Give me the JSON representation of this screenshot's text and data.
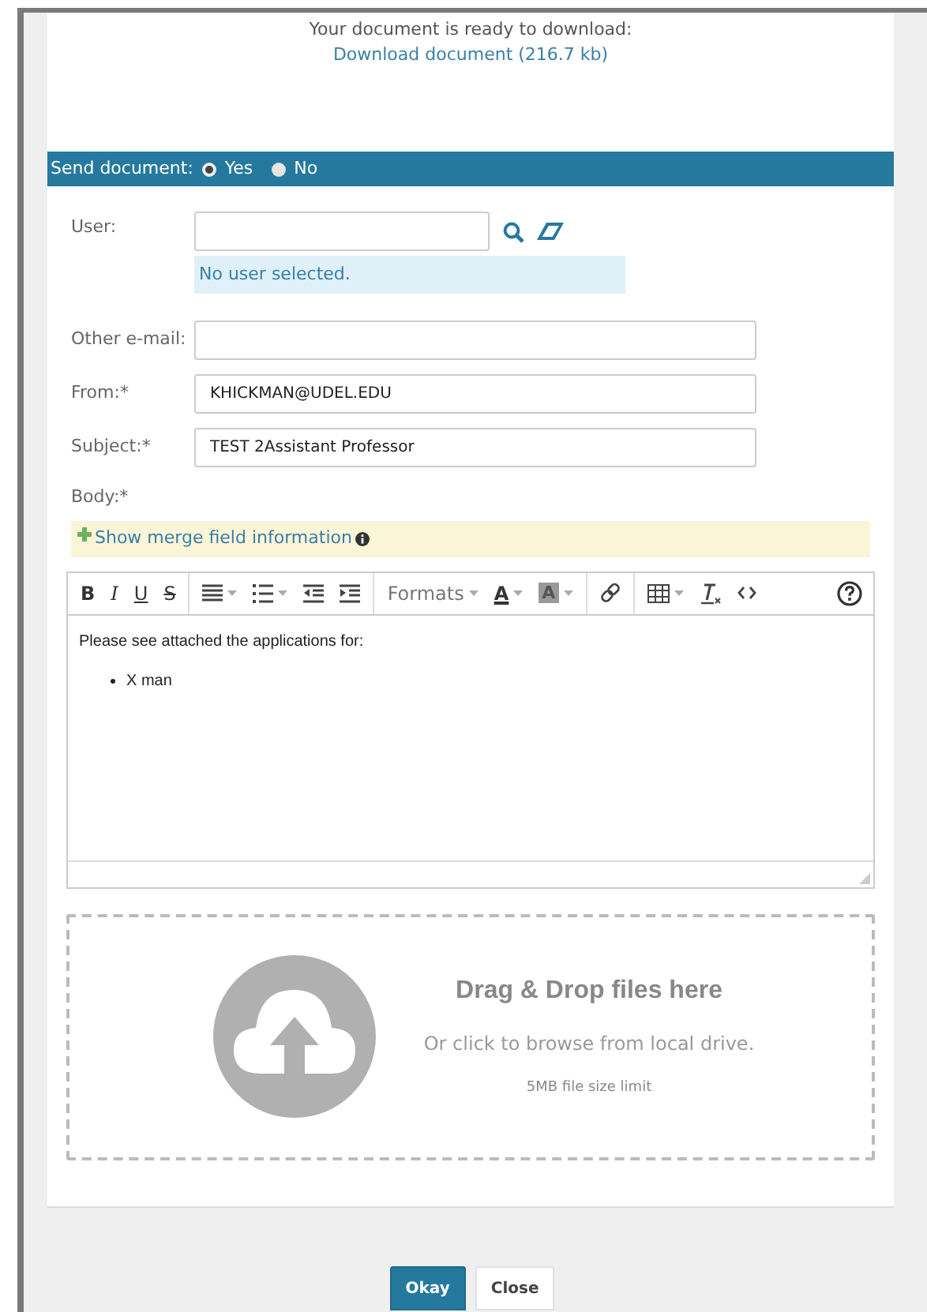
{
  "download": {
    "message": "Your document is ready to download:",
    "link": "Download document (216.7 kb)"
  },
  "send_document": {
    "label": "Send document:",
    "options": [
      {
        "label": "Yes",
        "selected": true
      },
      {
        "label": "No",
        "selected": false
      }
    ]
  },
  "form": {
    "user": {
      "label": "User:",
      "status": "No user selected."
    },
    "other_email": {
      "label": "Other e-mail:"
    },
    "from": {
      "label": "From:*",
      "value": "KHICKMAN@UDEL.EDU"
    },
    "subject": {
      "label": "Subject:*",
      "value": "TEST 2Assistant Professor"
    },
    "body_label": "Body:*"
  },
  "merge_info": {
    "label": "Show merge field information"
  },
  "editor": {
    "toolbar_groups": [
      [
        {
          "kind": "bold",
          "label": "B"
        },
        {
          "kind": "italic",
          "label": "I"
        },
        {
          "kind": "underline",
          "label": "U"
        },
        {
          "kind": "strike",
          "label": "S"
        }
      ],
      [
        {
          "kind": "align",
          "dropdown": true
        },
        {
          "kind": "list",
          "dropdown": true
        },
        {
          "kind": "outdent",
          "dropdown": false
        },
        {
          "kind": "indent",
          "dropdown": false
        }
      ],
      [
        {
          "kind": "formats",
          "label": "Formats",
          "dropdown": true
        },
        {
          "kind": "textcolor",
          "label": "A",
          "dropdown": true
        },
        {
          "kind": "bgcolor",
          "label": "A",
          "dropdown": true
        }
      ],
      [
        {
          "kind": "link",
          "dropdown": false
        }
      ],
      [
        {
          "kind": "table",
          "dropdown": true
        },
        {
          "kind": "clear",
          "dropdown": false
        },
        {
          "kind": "code",
          "dropdown": false
        }
      ]
    ],
    "content": {
      "paragraph": "Please see attached the applications for:",
      "bullets": [
        "X man"
      ]
    }
  },
  "dropzone": {
    "title": "Drag & Drop files here",
    "subtitle": "Or click to browse from local drive.",
    "limit": "5MB file size limit"
  },
  "buttons": [
    {
      "label": "Okay",
      "kind": "primary"
    },
    {
      "label": "Close",
      "kind": "secondary"
    }
  ]
}
